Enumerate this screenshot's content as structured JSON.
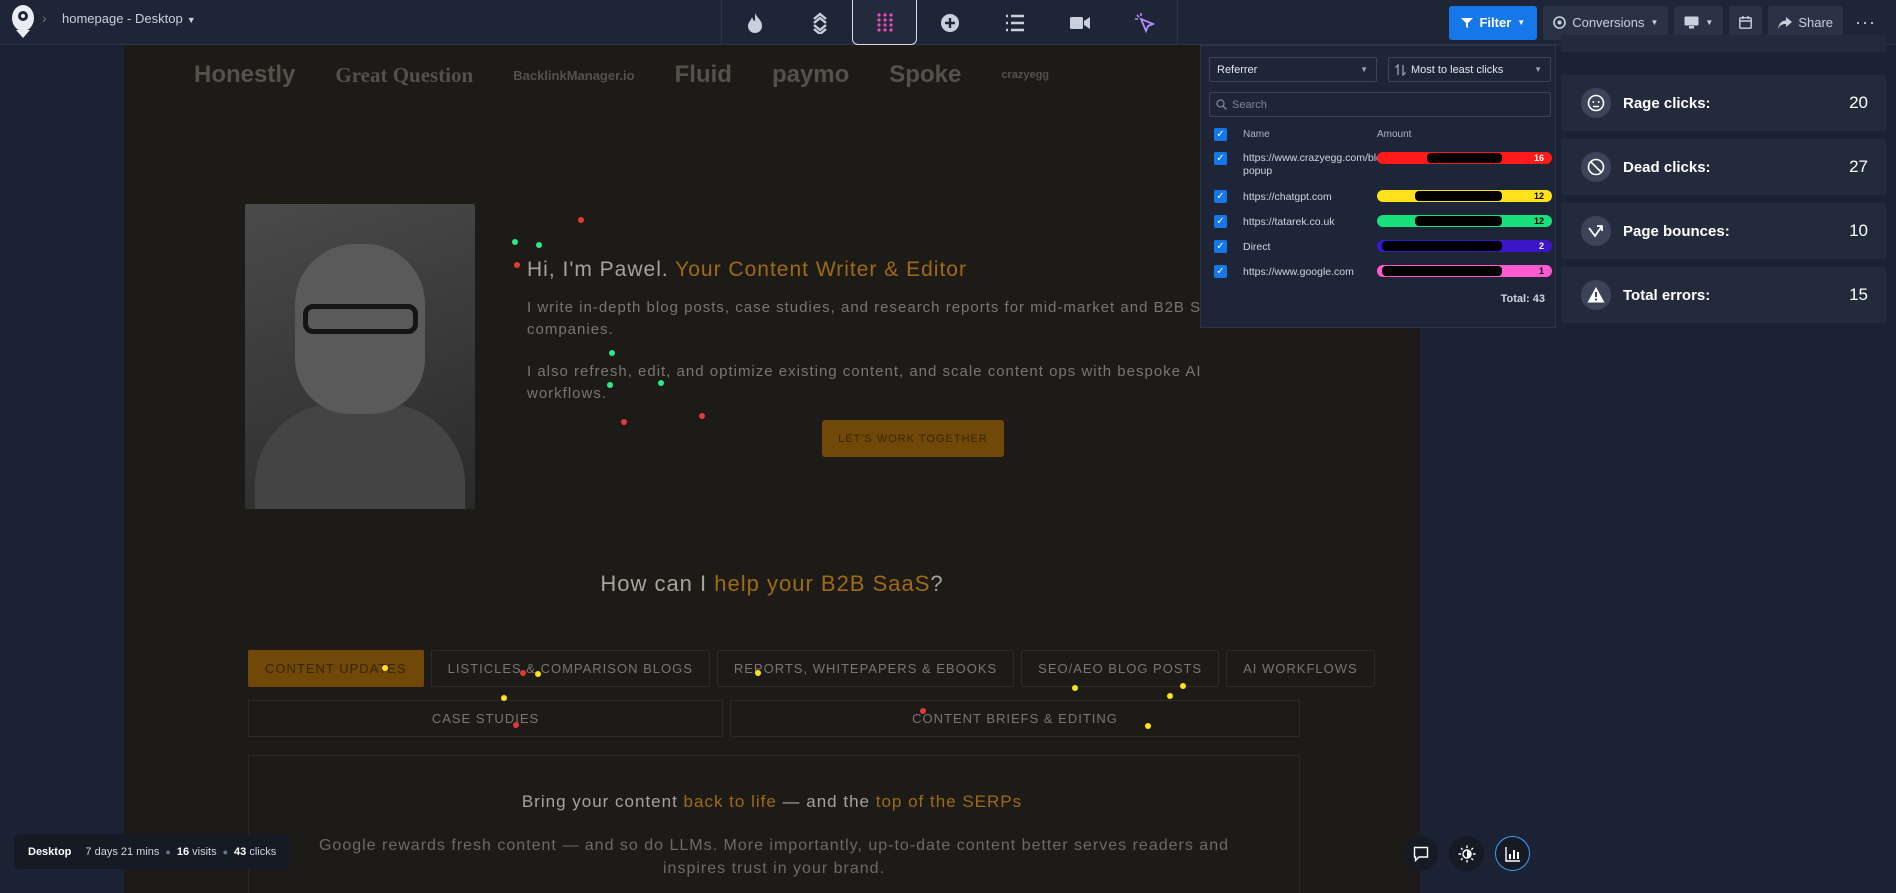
{
  "topbar": {
    "page_name": "homepage - Desktop",
    "modes": [
      "heatmap-icon",
      "scrollmap-icon",
      "clickmap-icon",
      "confetti-icon",
      "list-icon",
      "recording-icon",
      "pointer-icon"
    ],
    "filter_label": "Filter",
    "conversions_label": "Conversions",
    "share_label": "Share",
    "more_label": "···"
  },
  "site": {
    "logos": [
      "Honestly",
      "Great Question",
      "BacklinkManager.io",
      "Fluid",
      "paymo",
      "Spoke",
      "crazyegg"
    ],
    "hero_title_plain": "Hi, I'm Pawel.",
    "hero_title_accent": "Your Content Writer & Editor",
    "hero_p1": "I write in-depth blog posts, case studies, and research reports for mid-market and B2B SaaS companies.",
    "hero_p2": "I also refresh, edit, and optimize existing content, and scale content ops with bespoke AI workflows.",
    "cta_label": "LET'S WORK TOGETHER",
    "how_plain_1": "How can I",
    "how_accent": "help your B2B SaaS",
    "how_plain_2": "?",
    "tabs": [
      "CONTENT UPDATES",
      "LISTICLES & COMPARISON BLOGS",
      "REPORTS, WHITEPAPERS & EBOOKS",
      "SEO/AEO BLOG POSTS",
      "AI WORKFLOWS"
    ],
    "tabs_row2": [
      "CASE STUDIES",
      "CONTENT BRIEFS & EDITING"
    ],
    "panel_title_1": "Bring your content",
    "panel_title_accent_1": "back to life",
    "panel_title_2": "— and the",
    "panel_title_accent_2": "top of the SERPs",
    "panel_p": "Google rewards fresh content — and so do LLMs. More importantly, up-to-date content better serves readers and inspires trust in your brand."
  },
  "referrer_panel": {
    "group_by": "Referrer",
    "sort_by": "Most to least clicks",
    "search_placeholder": "Search",
    "col_name": "Name",
    "col_amount": "Amount",
    "rows": [
      {
        "name": "https://www.crazyegg.com/blog/exit-popup",
        "amount": "16",
        "color": "#ff1a1a"
      },
      {
        "name": "https://chatgpt.com",
        "amount": "12",
        "color": "#ffe21a"
      },
      {
        "name": "https://tatarek.co.uk",
        "amount": "12",
        "color": "#19e07a"
      },
      {
        "name": "Direct",
        "amount": "2",
        "color": "#3a16c8"
      },
      {
        "name": "https://www.google.com",
        "amount": "1",
        "color": "#ff5ad0"
      }
    ],
    "total": "Total: 43"
  },
  "stats": [
    {
      "label": "Rage clicks:",
      "value": "20",
      "icon": "rage-icon"
    },
    {
      "label": "Dead clicks:",
      "value": "27",
      "icon": "dead-click-icon"
    },
    {
      "label": "Page bounces:",
      "value": "10",
      "icon": "bounce-icon"
    },
    {
      "label": "Total errors:",
      "value": "15",
      "icon": "warning-icon"
    }
  ],
  "bottom_info": {
    "device": "Desktop",
    "duration": "7 days 21 mins",
    "visits_num": "16",
    "visits_label": "visits",
    "clicks_num": "43",
    "clicks_label": "clicks"
  }
}
